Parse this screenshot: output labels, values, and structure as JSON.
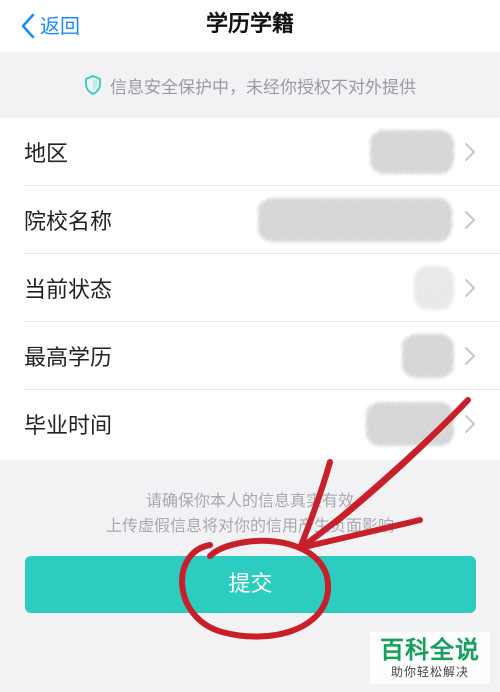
{
  "nav": {
    "back_label": "返回",
    "title": "学历学籍"
  },
  "notice": {
    "text": "信息安全保护中，未经你授权不对外提供"
  },
  "fields": [
    {
      "label": "地区"
    },
    {
      "label": "院校名称"
    },
    {
      "label": "当前状态"
    },
    {
      "label": "最高学历"
    },
    {
      "label": "毕业时间"
    }
  ],
  "footnote": {
    "line1": "请确保你本人的信息真实有效",
    "line2": "上传虚假信息将对你的信用产生负面影响"
  },
  "submit": {
    "label": "提交"
  },
  "watermark": {
    "brand": "百科全说",
    "tagline": "助你轻松解决"
  },
  "colors": {
    "accent": "#1a8cff",
    "button": "#2dccc1",
    "annotation": "#c8202a",
    "watermark": "#16a05c"
  },
  "icons": {
    "back": "chevron-left-icon",
    "notice": "shield-icon",
    "row": "chevron-right-icon"
  }
}
